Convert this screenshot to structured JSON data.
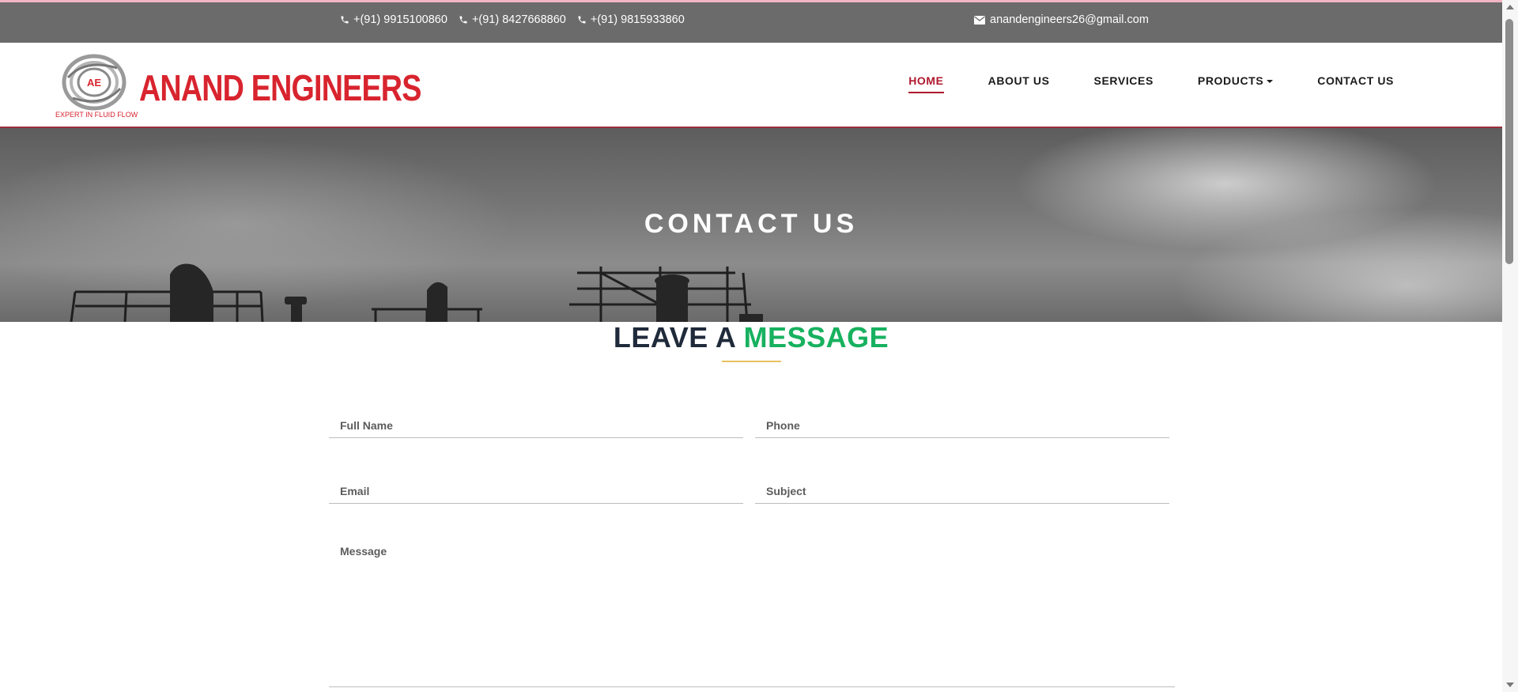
{
  "topbar": {
    "phones": [
      "+(91) 9915100860",
      "+(91) 8427668860",
      "+(91) 9815933860"
    ],
    "email": "anandengineers26@gmail.com"
  },
  "brand": {
    "name": "ANAND ENGINEERS",
    "tagline": "EXPERT IN FLUID FLOW",
    "mark_text": "AE",
    "color": "#d8242e"
  },
  "nav": {
    "items": [
      {
        "label": "HOME",
        "active": true
      },
      {
        "label": "ABOUT US",
        "active": false
      },
      {
        "label": "SERVICES",
        "active": false
      },
      {
        "label": "PRODUCTS",
        "active": false,
        "dropdown": true
      },
      {
        "label": "CONTACT US",
        "active": false
      }
    ]
  },
  "hero": {
    "title": "CONTACT US"
  },
  "section": {
    "title_dark": "LEAVE A ",
    "title_green": "MESSAGE",
    "accent": "#17b15f"
  },
  "form": {
    "full_name_placeholder": "Full Name",
    "phone_placeholder": "Phone",
    "email_placeholder": "Email",
    "subject_placeholder": "Subject",
    "message_placeholder": "Message"
  },
  "icons": [
    "phone-icon",
    "mail-icon",
    "caret-down-icon"
  ]
}
